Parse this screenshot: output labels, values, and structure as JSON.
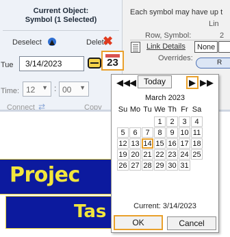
{
  "object_panel": {
    "title_line1": "Current Object:",
    "title_line2": "Symbol (1 Selected)",
    "deselect_label": "Deselect",
    "delete_label": "Delete",
    "delete_icon": "close-x-icon",
    "date_label": "Tue",
    "date_value": "3/14/2023",
    "calendar_button_day": "23",
    "time_label": "Time:",
    "hour_value": "12",
    "minute_value": "00",
    "time_separator": ":",
    "connect_label": "Connect",
    "copy_label": "Copy"
  },
  "link_panel": {
    "info_text": "Each symbol may have up t",
    "line_label": "Lin",
    "row_symbol_label": "Row, Symbol:",
    "row_symbol_value": "2",
    "link_details_label": "Link Details",
    "link_value": "None",
    "overrides_label": "Overrides:",
    "pill_button_label": "R"
  },
  "canvas": {
    "project_text": "Projec",
    "task_text": "Tas"
  },
  "calendar": {
    "today_label": "Today",
    "month_title": "March 2023",
    "weekdays": [
      "Su",
      "Mo",
      "Tu",
      "We",
      "Th",
      "Fr",
      "Sa"
    ],
    "days": [
      "1",
      "2",
      "3",
      "4",
      "5",
      "6",
      "7",
      "8",
      "9",
      "10",
      "11",
      "12",
      "13",
      "14",
      "15",
      "16",
      "17",
      "18",
      "19",
      "20",
      "21",
      "22",
      "23",
      "24",
      "25",
      "26",
      "27",
      "28",
      "29",
      "30",
      "31"
    ],
    "selected_day": "14",
    "current_text": "Current: 3/14/2023",
    "ok_label": "OK",
    "cancel_label": "Cancel"
  },
  "colors": {
    "highlight": "#e9a02a",
    "canvas_blue": "#0c1a9e",
    "canvas_yellow": "#f2e63c",
    "delete_red": "#e03b1f"
  }
}
